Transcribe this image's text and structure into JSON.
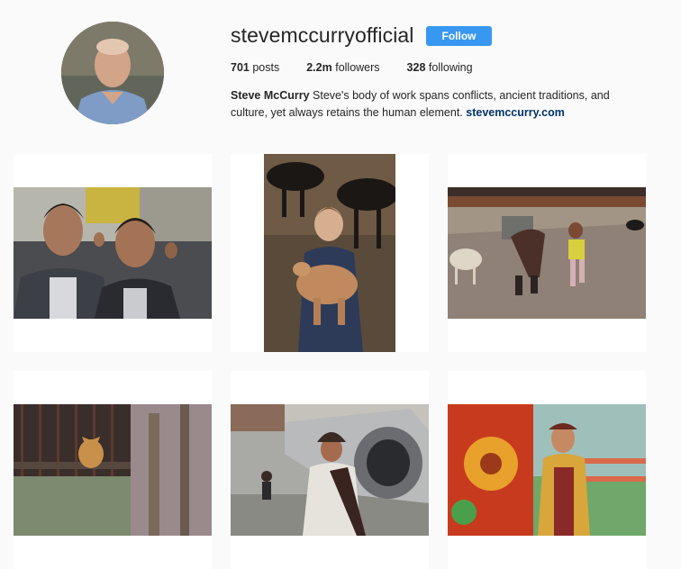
{
  "profile": {
    "username": "stevemccurryofficial",
    "follow_label": "Follow",
    "stats": {
      "posts_count": "701",
      "posts_label": "posts",
      "followers_count": "2.2m",
      "followers_label": "followers",
      "following_count": "328",
      "following_label": "following"
    },
    "bio": {
      "name": "Steve McCurry",
      "text": "Steve's body of work spans conflicts, ancient traditions, and culture, yet always retains the human element.",
      "link": "stevemccurry.com"
    }
  },
  "colors": {
    "page_background": "#fafafa",
    "follow_button": "#3897f0",
    "link": "#003569"
  },
  "posts_icon": "image-thumbnail-icon"
}
